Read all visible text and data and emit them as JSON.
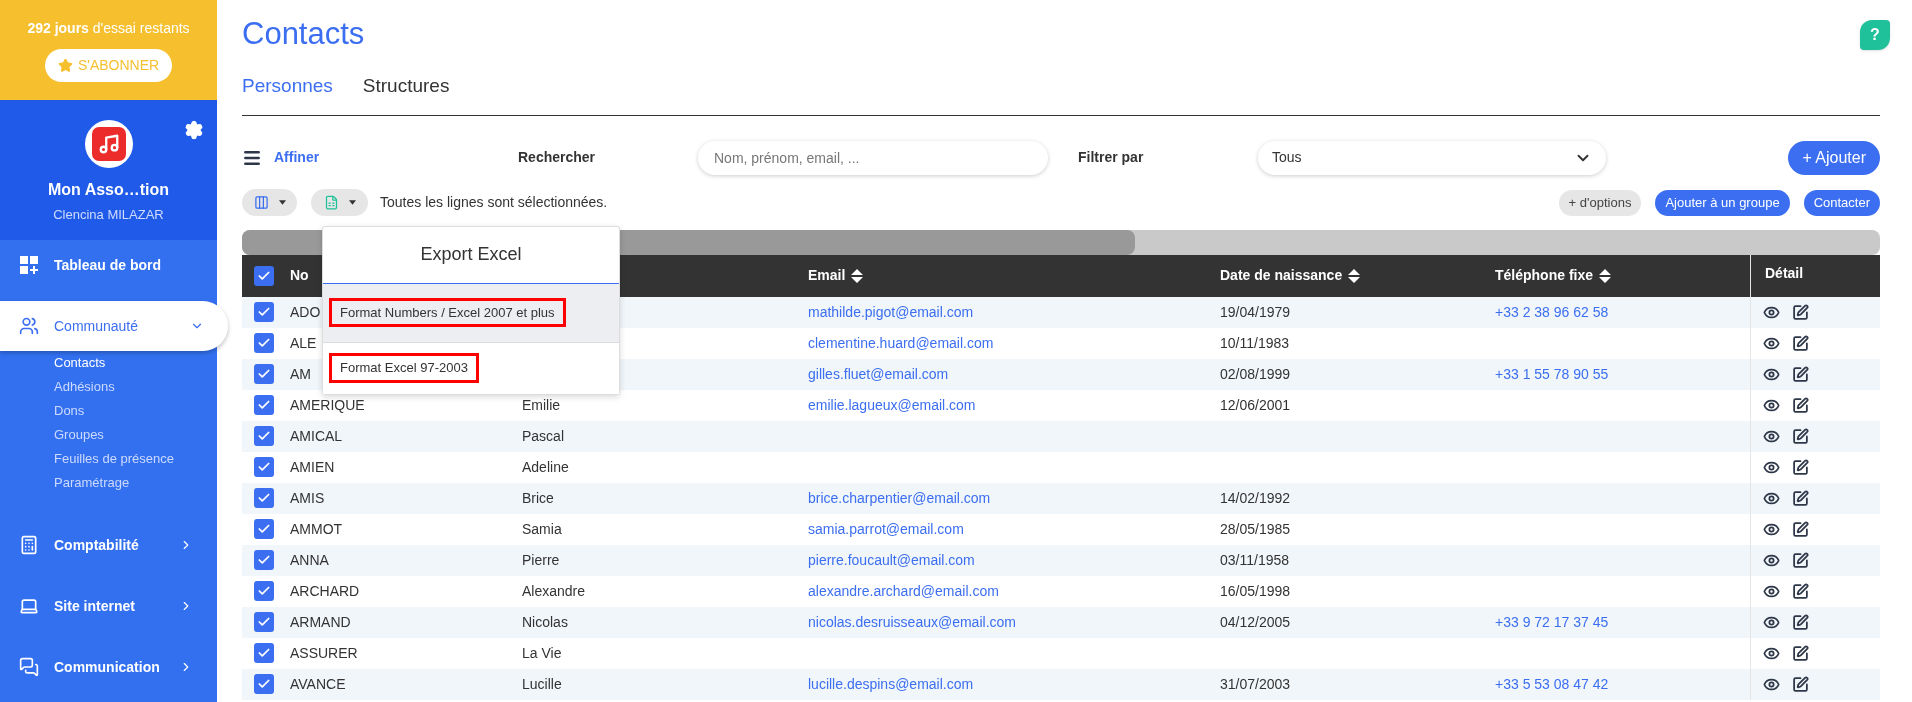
{
  "sidebar": {
    "trial": "**292 jours** d'essai restants",
    "subscribe_button": "S'ABONNER",
    "organization": "Mon Asso…tion",
    "user": "Clencina MILAZAR",
    "nav": [
      {
        "label": "Tableau de bord",
        "selected": false
      },
      {
        "label": "Communauté",
        "selected": true,
        "expanded": true,
        "children": [
          {
            "label": "Contacts",
            "selected": true
          },
          {
            "label": "Adhésions",
            "selected": false
          },
          {
            "label": "Dons",
            "selected": false
          },
          {
            "label": "Groupes",
            "selected": false
          },
          {
            "label": "Feuilles de présence",
            "selected": false
          },
          {
            "label": "Paramétrage",
            "selected": false
          }
        ]
      },
      {
        "label": "Comptabilité",
        "selected": false,
        "expanded": false
      },
      {
        "label": "Site internet",
        "selected": false,
        "expanded": false
      },
      {
        "label": "Communication",
        "selected": false,
        "expanded": false
      }
    ]
  },
  "page": {
    "title": "Contacts",
    "help_button": "?",
    "tabs": [
      {
        "label": "Personnes",
        "selected": true
      },
      {
        "label": "Structures",
        "selected": false
      }
    ]
  },
  "filters": {
    "refine_link": "Affiner",
    "search_label": "Rechercher",
    "search": {
      "placeholder": "Nom, prénom, email, ..."
    },
    "filter_label": "Filtrer par",
    "filter_select": {
      "value": "Tous"
    },
    "add_button": "+ Ajouter"
  },
  "toolbar": {
    "selection_text": "Toutes les lignes sont sélectionnées.",
    "buttons": [
      {
        "label": "+ d'options",
        "kind": "secondary"
      },
      {
        "label": "Ajouter à un groupe",
        "kind": "primary"
      },
      {
        "label": "Contacter",
        "kind": "primary"
      }
    ]
  },
  "export_menu": {
    "title": "Export Excel",
    "items": [
      {
        "label": "Format Numbers / Excel 2007 et plus",
        "highlighted": true,
        "annotated": true
      },
      {
        "label": "Format Excel 97-2003",
        "highlighted": false,
        "annotated": true
      }
    ]
  },
  "table": {
    "all_checked": true,
    "header": {
      "name": "No",
      "email": "Email",
      "birth_date": "Date de naissance",
      "phone": "Téléphone fixe",
      "detail": "Détail"
    },
    "rows": [
      {
        "checked": true,
        "last_name": "ADO",
        "email": "mathilde.pigot@email.com",
        "birth_date": "19/04/1979",
        "phone": "+33 2 38 96 62 58"
      },
      {
        "checked": true,
        "last_name": "ALE",
        "email": "clementine.huard@email.com",
        "birth_date": "10/11/1983"
      },
      {
        "checked": true,
        "last_name": "AM",
        "email": "gilles.fluet@email.com",
        "birth_date": "02/08/1999",
        "phone": "+33 1 55 78 90 55"
      },
      {
        "checked": true,
        "last_name": "AMERIQUE",
        "first_name": "Emilie",
        "email": "emilie.lagueux@email.com",
        "birth_date": "12/06/2001"
      },
      {
        "checked": true,
        "last_name": "AMICAL",
        "first_name": "Pascal"
      },
      {
        "checked": true,
        "last_name": "AMIEN",
        "first_name": "Adeline"
      },
      {
        "checked": true,
        "last_name": "AMIS",
        "first_name": "Brice",
        "email": "brice.charpentier@email.com",
        "birth_date": "14/02/1992"
      },
      {
        "checked": true,
        "last_name": "AMMOT",
        "first_name": "Samia",
        "email": "samia.parrot@email.com",
        "birth_date": "28/05/1985"
      },
      {
        "checked": true,
        "last_name": "ANNA",
        "first_name": "Pierre",
        "email": "pierre.foucault@email.com",
        "birth_date": "03/11/1958"
      },
      {
        "checked": true,
        "last_name": "ARCHARD",
        "first_name": "Alexandre",
        "email": "alexandre.archard@email.com",
        "birth_date": "16/05/1998"
      },
      {
        "checked": true,
        "last_name": "ARMAND",
        "first_name": "Nicolas",
        "email": "nicolas.desruisseaux@email.com",
        "birth_date": "04/12/2005",
        "phone": "+33 9 72 17 37 45"
      },
      {
        "checked": true,
        "last_name": "ASSURER",
        "first_name": "La Vie"
      },
      {
        "checked": true,
        "last_name": "AVANCE",
        "first_name": "Lucille",
        "email": "lucille.despins@email.com",
        "birth_date": "31/07/2003",
        "phone": "+33 5 53 08 47 42"
      }
    ]
  }
}
